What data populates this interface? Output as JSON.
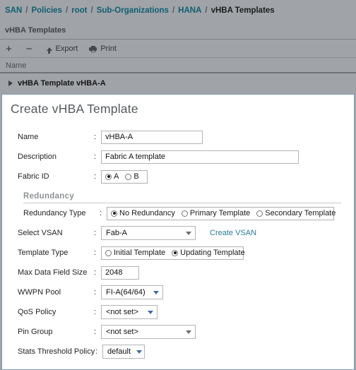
{
  "breadcrumb": {
    "items": [
      {
        "label": "SAN",
        "current": false
      },
      {
        "label": "Policies",
        "current": false
      },
      {
        "label": "root",
        "current": false
      },
      {
        "label": "Sub-Organizations",
        "current": false
      },
      {
        "label": "HANA",
        "current": false
      },
      {
        "label": "vHBA Templates",
        "current": true
      }
    ],
    "separator": "/"
  },
  "page": {
    "subtitle": "vHBA Templates"
  },
  "toolbar": {
    "add_label": "+",
    "remove_label": "−",
    "export_label": "Export",
    "print_label": "Print"
  },
  "grid": {
    "column_name": "Name",
    "rows": [
      {
        "label": "vHBA Template vHBA-A"
      }
    ]
  },
  "dialog": {
    "title": "Create vHBA Template",
    "fields": {
      "name": {
        "label": "Name",
        "colon": ":",
        "value": "vHBA-A",
        "placeholder": ""
      },
      "description": {
        "label": "Description",
        "colon": ":",
        "value": "Fabric A template",
        "placeholder": ""
      },
      "fabric_id": {
        "label": "Fabric ID",
        "colon": ":",
        "options": [
          {
            "label": "A",
            "selected": true
          },
          {
            "label": "B",
            "selected": false
          }
        ]
      },
      "redundancy_section": {
        "label": "Redundancy"
      },
      "redundancy_type": {
        "label": "Redundancy Type",
        "colon": ":",
        "options": [
          {
            "label": "No Redundancy",
            "selected": true
          },
          {
            "label": "Primary Template",
            "selected": false
          },
          {
            "label": "Secondary Template",
            "selected": false
          }
        ]
      },
      "select_vsan": {
        "label": "Select VSAN",
        "colon": ":",
        "value": "Fab-A",
        "link_label": "Create VSAN"
      },
      "template_type": {
        "label": "Template Type",
        "colon": ":",
        "options": [
          {
            "label": "Initial Template",
            "selected": false
          },
          {
            "label": "Updating Template",
            "selected": true
          }
        ]
      },
      "max_data_field_size": {
        "label": "Max Data Field Size",
        "colon": ":",
        "value": "2048"
      },
      "wwpn_pool": {
        "label": "WWPN Pool",
        "colon": ":",
        "value": "FI-A(64/64)"
      },
      "qos_policy": {
        "label": "QoS Policy",
        "colon": ":",
        "value": "<not set>"
      },
      "pin_group": {
        "label": "Pin Group",
        "colon": ":",
        "value": "<not set>"
      },
      "stats_threshold_policy": {
        "label": "Stats Threshold Policy",
        "colon": ":",
        "value": "default"
      }
    }
  },
  "colors": {
    "chrome_bg": "#a0a4a8",
    "crumb_link": "#0f5e72",
    "dialog_border": "#7f9bb8",
    "link": "#2a7c99",
    "caret_blue": "#3b6ea5"
  }
}
